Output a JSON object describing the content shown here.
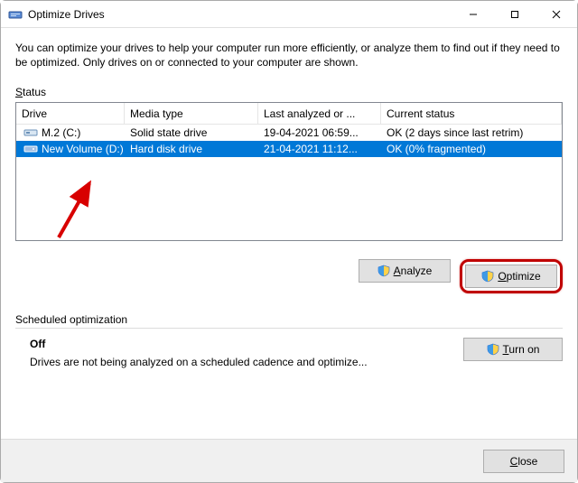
{
  "window": {
    "title": "Optimize Drives"
  },
  "intro": "You can optimize your drives to help your computer run more efficiently, or analyze them to find out if they need to be optimized. Only drives on or connected to your computer are shown.",
  "status_label_prefix": "S",
  "status_label_rest": "tatus",
  "columns": {
    "drive": "Drive",
    "media": "Media type",
    "last": "Last analyzed or ...",
    "status": "Current status"
  },
  "drives": [
    {
      "name": "M.2 (C:)",
      "media": "Solid state drive",
      "last": "19-04-2021 06:59...",
      "status": "OK (2 days since last retrim)",
      "icon": "ssd",
      "selected": false
    },
    {
      "name": "New Volume (D:)",
      "media": "Hard disk drive",
      "last": "21-04-2021 11:12...",
      "status": "OK (0% fragmented)",
      "icon": "hdd",
      "selected": true
    }
  ],
  "buttons": {
    "analyze_u": "A",
    "analyze_rest": "nalyze",
    "optimize_u": "O",
    "optimize_rest": "ptimize",
    "turnon_u": "T",
    "turnon_rest": "urn on",
    "close_u": "C",
    "close_rest": "lose"
  },
  "sched": {
    "heading": "Scheduled optimization",
    "state": "Off",
    "desc": "Drives are not being analyzed on a scheduled cadence and optimize..."
  }
}
